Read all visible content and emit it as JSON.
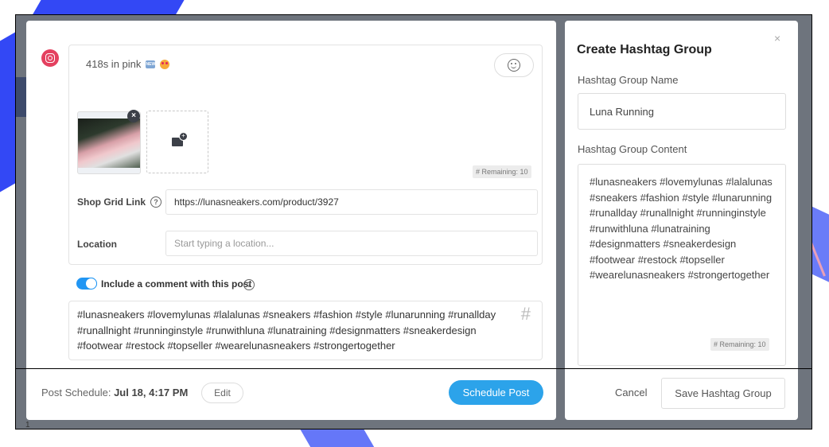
{
  "post": {
    "network_icon": "instagram-icon",
    "caption": "418s in pink",
    "caption_emojis": [
      "new-badge-emoji",
      "heart-eyes-emoji"
    ],
    "new_badge_text": "NEW",
    "emoji_button_icon": "smiley-icon",
    "media_remove_icon": "×",
    "remaining_label": "# Remaining: 10",
    "shop_grid_label": "Shop Grid Link",
    "shop_grid_value": "https://lunasneakers.com/product/3927",
    "help_glyph": "?",
    "location_label": "Location",
    "location_placeholder": "Start typing a location...",
    "comment_toggle": {
      "label": "Include a comment with this post",
      "enabled": true
    },
    "comment_text": "#lunasneakers #lovemylunas #lalalunas #sneakers #fashion #style #lunarunning #runallday #runallnight #runninginstyle #runwithluna #lunatraining #designmatters #sneakerdesign #footwear #restock #topseller #wearelunasneakers #strongertogether",
    "hash_glyph": "#"
  },
  "footer": {
    "schedule_prefix": "Post Schedule: ",
    "schedule_value": "Jul 18, 4:17 PM",
    "edit_label": "Edit",
    "schedule_button": "Schedule Post"
  },
  "hashtag_group": {
    "title": "Create Hashtag Group",
    "close_glyph": "×",
    "name_label": "Hashtag Group Name",
    "name_value": "Luna Running",
    "content_label": "Hashtag Group Content",
    "content_value": "#lunasneakers #lovemylunas #lalalunas #sneakers #fashion #style #lunarunning #runallday #runallnight #runninginstyle #runwithluna #lunatraining #designmatters #sneakerdesign #footwear #restock #topseller #wearelunasneakers #strongertogether",
    "remaining_label": "# Remaining: 10",
    "cancel_label": "Cancel",
    "save_label": "Save Hashtag Group"
  },
  "background": {
    "row_number": "1"
  },
  "colors": {
    "accent_blue": "#2ca3ea",
    "toggle_blue": "#2196f3",
    "instagram": "#e4405f",
    "overlay": "#6e747d",
    "brush_blue": "#3348f5"
  }
}
